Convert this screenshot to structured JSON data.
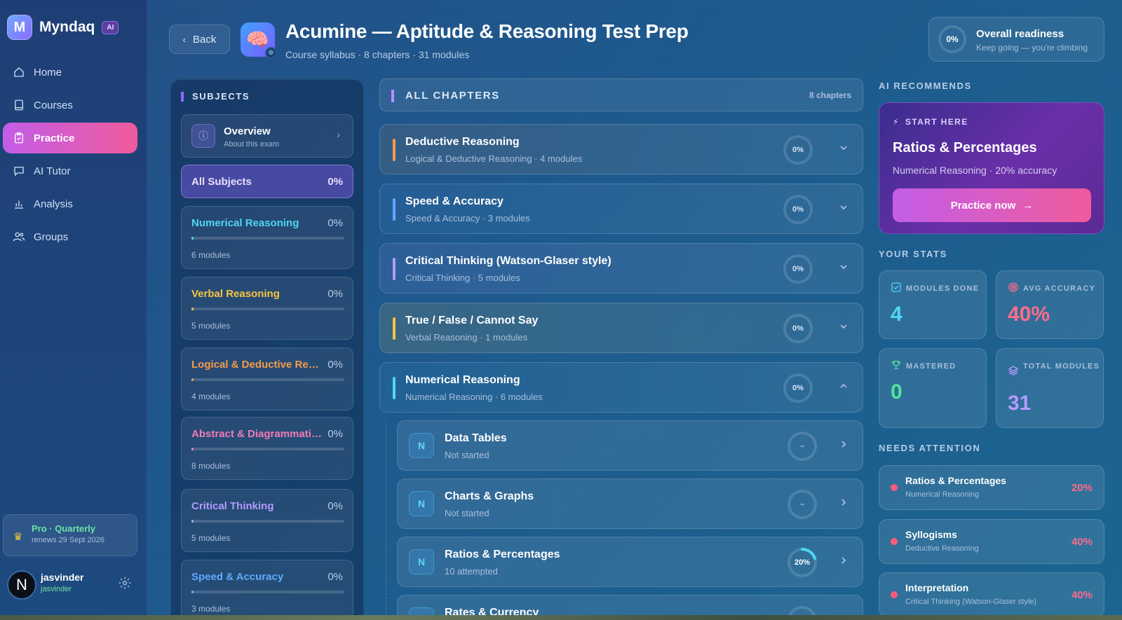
{
  "app": {
    "name": "Myndaq",
    "badge": "AI"
  },
  "nav": [
    {
      "label": "Home",
      "icon": "home-icon"
    },
    {
      "label": "Courses",
      "icon": "book-icon"
    },
    {
      "label": "Practice",
      "icon": "clipboard-icon",
      "active": true
    },
    {
      "label": "AI Tutor",
      "icon": "chat-icon"
    },
    {
      "label": "Analysis",
      "icon": "bar-chart-icon"
    },
    {
      "label": "Groups",
      "icon": "users-icon"
    }
  ],
  "plan": {
    "title": "Pro · Quarterly",
    "renews": "renews 29 Sept 2026"
  },
  "user": {
    "initial": "N",
    "name": "jasvinder",
    "handle": "jasvinder"
  },
  "header": {
    "back_label": "Back",
    "title": "Acumine — Aptitude & Reasoning Test Prep",
    "subtitle": "Course syllabus · 8 chapters · 31 modules"
  },
  "readiness": {
    "value": "0%",
    "title": "Overall readiness",
    "sub": "Keep going — you're climbing"
  },
  "subjects": {
    "heading": "SUBJECTS",
    "overview": {
      "title": "Overview",
      "sub": "About this exam"
    },
    "all": {
      "label": "All Subjects",
      "pct": "0%"
    },
    "items": [
      {
        "name": "Numerical Reasoning",
        "pct": "0%",
        "modules": "6 modules",
        "color": "#4fd6f2",
        "progress": 0
      },
      {
        "name": "Verbal Reasoning",
        "pct": "0%",
        "modules": "5 modules",
        "color": "#f5c542",
        "progress": 0
      },
      {
        "name": "Logical & Deductive Reasoning",
        "pct": "0%",
        "modules": "4 modules",
        "color": "#f59b4c",
        "progress": 0
      },
      {
        "name": "Abstract & Diagrammatic Reasoning",
        "pct": "0%",
        "modules": "8 modules",
        "color": "#f27bb8",
        "progress": 0
      },
      {
        "name": "Critical Thinking",
        "pct": "0%",
        "modules": "5 modules",
        "color": "#b39bff",
        "progress": 0
      },
      {
        "name": "Speed & Accuracy",
        "pct": "0%",
        "modules": "3 modules",
        "color": "#5fa9ff",
        "progress": 0
      }
    ]
  },
  "chapters": {
    "heading": "ALL CHAPTERS",
    "count": "8 chapters",
    "items": [
      {
        "title": "Deductive Reasoning",
        "sub": "Logical & Deductive Reasoning · 4 modules",
        "pct": "0%",
        "color": "#f59b4c",
        "tint": "rgba(245,155,76,0.10)",
        "expanded": false
      },
      {
        "title": "Speed & Accuracy",
        "sub": "Speed & Accuracy · 3 modules",
        "pct": "0%",
        "color": "#5fa9ff",
        "tint": "rgba(95,169,255,0.08)",
        "expanded": false
      },
      {
        "title": "Critical Thinking (Watson-Glaser style)",
        "sub": "Critical Thinking · 5 modules",
        "pct": "0%",
        "color": "#b39bff",
        "tint": "rgba(179,155,255,0.10)",
        "expanded": false
      },
      {
        "title": "True / False / Cannot Say",
        "sub": "Verbal Reasoning · 1 modules",
        "pct": "0%",
        "color": "#f5c542",
        "tint": "rgba(245,197,66,0.12)",
        "expanded": false
      },
      {
        "title": "Numerical Reasoning",
        "sub": "Numerical Reasoning · 6 modules",
        "pct": "0%",
        "color": "#4fd6f2",
        "tint": "rgba(79,214,242,0.06)",
        "expanded": true
      }
    ]
  },
  "modules": [
    {
      "letter": "N",
      "title": "Data Tables",
      "sub": "Not started",
      "value": "–",
      "progress": 0
    },
    {
      "letter": "N",
      "title": "Charts & Graphs",
      "sub": "Not started",
      "value": "–",
      "progress": 0
    },
    {
      "letter": "N",
      "title": "Ratios & Percentages",
      "sub": "10 attempted",
      "value": "20%",
      "progress": 0.2
    },
    {
      "letter": "N",
      "title": "Rates & Currency",
      "sub": "",
      "value": "",
      "progress": 0
    }
  ],
  "recommend": {
    "heading": "AI RECOMMENDS",
    "tag": "START HERE",
    "title": "Ratios & Percentages",
    "sub": "Numerical Reasoning · 20% accuracy",
    "button": "Practice now"
  },
  "stats": {
    "heading": "YOUR STATS",
    "items": [
      {
        "label": "MODULES DONE",
        "value": "4",
        "color": "#4fd6f2",
        "icon": "checkbox-icon"
      },
      {
        "label": "AVG ACCURACY",
        "value": "40%",
        "color": "#ff6b8a",
        "icon": "target-icon"
      },
      {
        "label": "MASTERED",
        "value": "0",
        "color": "#4fe39a",
        "icon": "trophy-icon"
      },
      {
        "label": "TOTAL MODULES",
        "value": "31",
        "color": "#b39bff",
        "icon": "layers-icon"
      }
    ]
  },
  "attention": {
    "heading": "NEEDS ATTENTION",
    "items": [
      {
        "title": "Ratios & Percentages",
        "sub": "Numerical Reasoning",
        "pct": "20%"
      },
      {
        "title": "Syllogisms",
        "sub": "Deductive Reasoning",
        "pct": "40%"
      },
      {
        "title": "Interpretation",
        "sub": "Critical Thinking (Watson-Glaser style)",
        "pct": "40%"
      }
    ]
  }
}
